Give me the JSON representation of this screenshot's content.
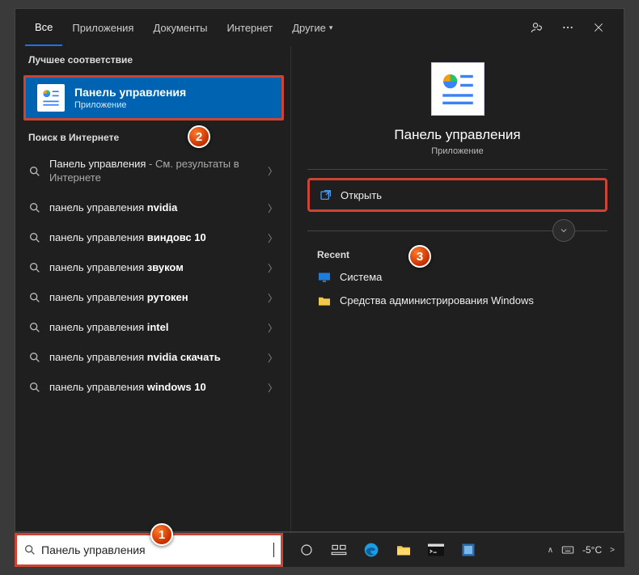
{
  "tabs": {
    "all": "Все",
    "apps": "Приложения",
    "docs": "Документы",
    "web": "Интернет",
    "more": "Другие"
  },
  "sections": {
    "best": "Лучшее соответствие",
    "web": "Поиск в Интернете"
  },
  "bestMatch": {
    "title": "Панель управления",
    "sub": "Приложение"
  },
  "results": [
    {
      "pre": "Панель управления",
      "suf": " - См. результаты в Интернете",
      "bold": ""
    },
    {
      "pre": "панель управления ",
      "bold": "nvidia"
    },
    {
      "pre": "панель управления ",
      "bold": "виндовс 10"
    },
    {
      "pre": "панель управления ",
      "bold": "звуком"
    },
    {
      "pre": "панель управления ",
      "bold": "рутокен"
    },
    {
      "pre": "панель управления ",
      "bold": "intel"
    },
    {
      "pre": "панель управления ",
      "bold": "nvidia скачать"
    },
    {
      "pre": "панель управления ",
      "bold": "windows 10"
    }
  ],
  "preview": {
    "title": "Панель управления",
    "sub": "Приложение",
    "open": "Открыть",
    "recent": "Recent",
    "items": [
      {
        "label": "Система",
        "color": "#1e7dd9"
      },
      {
        "label": "Средства администрирования Windows",
        "color": "#f0c84b"
      }
    ]
  },
  "search": {
    "value": "Панель управления"
  },
  "tray": {
    "temp": "-5°C"
  },
  "steps": {
    "s1": "1",
    "s2": "2",
    "s3": "3"
  }
}
